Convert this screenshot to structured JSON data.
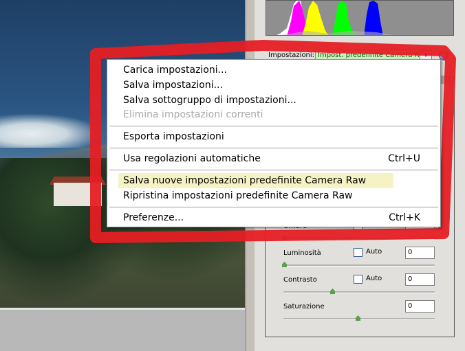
{
  "right_panel": {
    "settings_label": "Impostazioni:",
    "settings_value": "Impost. predefinite Camera Raw",
    "dropdown_arrow": "▾",
    "menu_icon": "▸",
    "sliders": [
      {
        "label": "Ombre",
        "auto_label": "Auto",
        "value": "",
        "position": 0.0
      },
      {
        "label": "Luminosità",
        "auto_label": "Auto",
        "value": "0",
        "position": 0.0
      },
      {
        "label": "Contrasto",
        "auto_label": "Auto",
        "value": "0",
        "position": 0.33
      },
      {
        "label": "Saturazione",
        "auto_label": "",
        "value": "0",
        "position": 0.5
      }
    ]
  },
  "context_menu": {
    "items": [
      {
        "label": "Carica impostazioni...",
        "shortcut": ""
      },
      {
        "label": "Salva impostazioni...",
        "shortcut": ""
      },
      {
        "label": "Salva sottogruppo di impostazioni...",
        "shortcut": ""
      },
      {
        "label": "Elimina impostazioni correnti",
        "shortcut": "",
        "disabled": true
      },
      {
        "label": "Esporta impostazioni",
        "shortcut": ""
      },
      {
        "label": "Usa regolazioni automatiche",
        "shortcut": "Ctrl+U"
      },
      {
        "label": "Salva nuove impostazioni predefinite Camera Raw",
        "shortcut": "",
        "highlighted": true
      },
      {
        "label": "Ripristina impostazioni predefinite Camera Raw",
        "shortcut": ""
      },
      {
        "label": "Preferenze...",
        "shortcut": "Ctrl+K"
      }
    ]
  },
  "colors": {
    "highlight_red": "#e51f24",
    "select_bg": "#cfeec0",
    "menu_highlight": "#f5f3c4",
    "slider_thumb": "#5aa04a"
  }
}
